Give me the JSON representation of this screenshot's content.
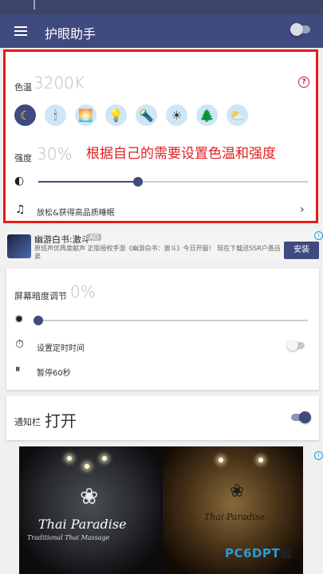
{
  "app": {
    "title": "护眼助手",
    "menu_icon": "hamburger-icon",
    "master_toggle": false
  },
  "filter": {
    "temp_label": "色温",
    "temp_value": "3200K",
    "temp_presets": [
      {
        "name": "moon-icon",
        "glyph": "☾",
        "active": true
      },
      {
        "name": "candle-icon",
        "glyph": "🕯"
      },
      {
        "name": "sunrise-icon",
        "glyph": "🌅"
      },
      {
        "name": "bulb-icon",
        "glyph": "💡"
      },
      {
        "name": "fluorescent-icon",
        "glyph": "🔦"
      },
      {
        "name": "sun-icon",
        "glyph": "☀"
      },
      {
        "name": "trees-icon",
        "glyph": "🌲"
      },
      {
        "name": "partly-cloudy-icon",
        "glyph": "⛅"
      }
    ],
    "intensity_label": "强度",
    "intensity_value": "30%",
    "intensity_fraction": 0.37,
    "sleep_text": "放松&获得高品质睡眠",
    "annotation": "根据自己的需要设置色温和强度"
  },
  "ad": {
    "title": "幽游白书:激斗",
    "tag": "AD",
    "desc": "原班声优再度献声 正版授权手游《幽游白书：激斗》今日开服！ 现在下载送SSR户愚吕弟",
    "button": "安装"
  },
  "brightness": {
    "label": "屏幕暗度调节",
    "value": "0%",
    "fraction": 0.0,
    "timer_label": "设置定时时间",
    "timer_enabled": false,
    "pause_label": "暂停60秒"
  },
  "notification": {
    "label": "通知栏",
    "value": "打开",
    "enabled": true
  },
  "banner": {
    "brand_left": "Thai Paradise",
    "sub_left": "Traditional Thai Massage",
    "brand_right": "Thai Paradise"
  },
  "watermark": {
    "brand": "PC6DPT",
    "suffix": "载"
  },
  "colors": {
    "primary": "#3f4a7e",
    "highlight": "#e21d1d",
    "help": "#c21a5e"
  }
}
